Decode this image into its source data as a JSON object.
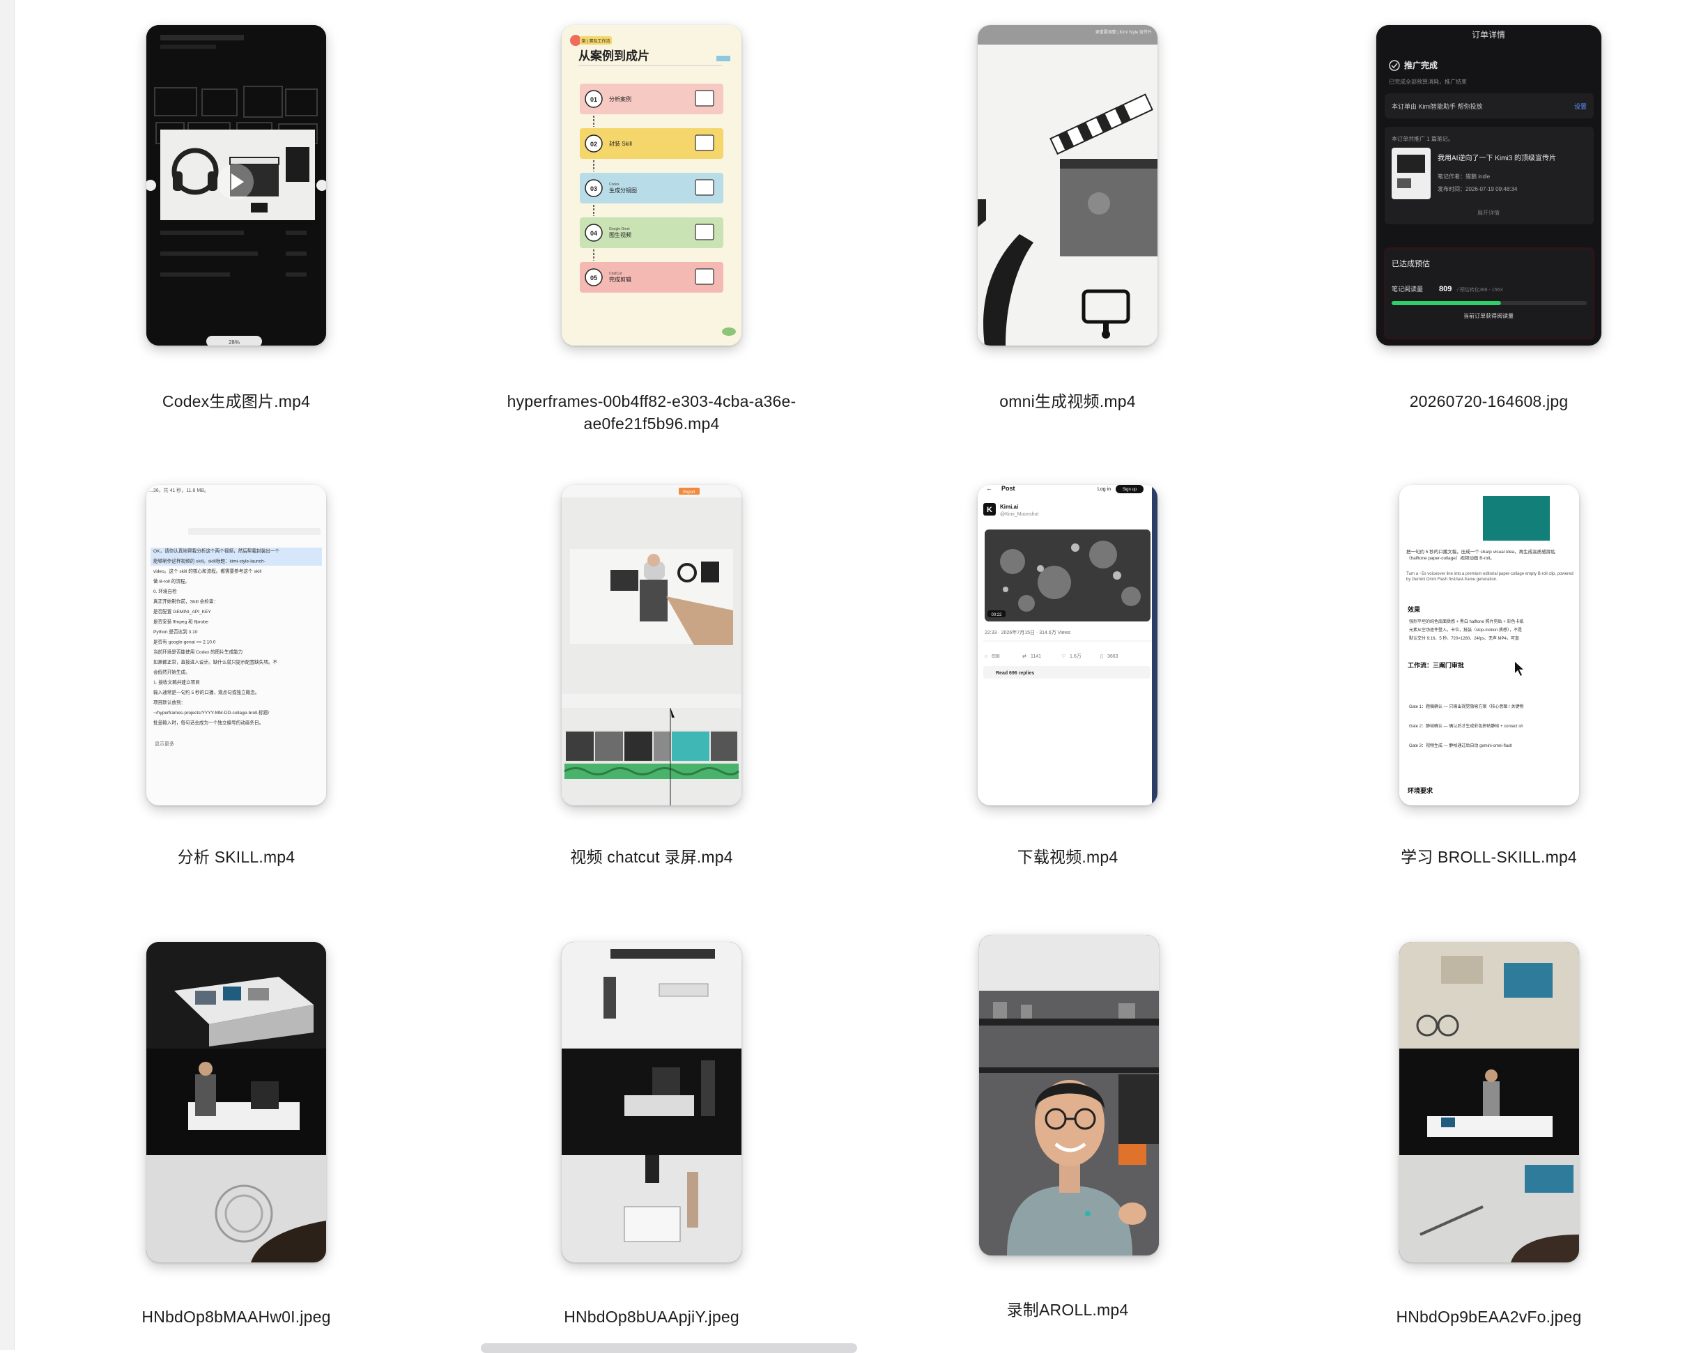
{
  "files": [
    {
      "name": "Codex生成图片.mp4",
      "thumb": {
        "zoom": "28%"
      }
    },
    {
      "name": "hyperframes-00b4ff82-e303-4cba-a36e-ae0fe21f5b96.mp4",
      "thumb": {
        "heading": "从案例到成片",
        "tag": "案 | 實际工作流",
        "steps": [
          {
            "num": "01",
            "sub": "",
            "label": "分析案例",
            "color": "#f7c9c3"
          },
          {
            "num": "02",
            "sub": "",
            "label": "封装 Skill",
            "color": "#f4d66a"
          },
          {
            "num": "03",
            "sub": "Codex",
            "label": "生成分镜图",
            "color": "#b9dde8"
          },
          {
            "num": "04",
            "sub": "Google Omni",
            "label": "图生视频",
            "color": "#c9e3b4"
          },
          {
            "num": "05",
            "sub": "ChatCut",
            "label": "完成剪辑",
            "color": "#f5b9b4"
          }
        ]
      }
    },
    {
      "name": "omni生成视频.mp4",
      "thumb": {
        "topbar": "更重要调整 | Kimi Style 宣传片"
      }
    },
    {
      "name": "20260720-164608.jpg",
      "thumb": {
        "title": "订单详情",
        "done": "推广完成",
        "done_sub": "已完成全部预算消耗，推广结束",
        "agent": "本订单由 Kimi智能助手 帮你投放",
        "agent_link": "设置",
        "count_line": "本订单共推广 1 篇笔记。",
        "note_title": "我用AI逆向了一下 Kimi3 的顶级宣传片",
        "author": "笔记作者：猎鹅 indie",
        "time": "发布时间：2026-07-19 09:48:34",
        "expand": "展开详情",
        "reach": "已达成预估",
        "read_label": "笔记阅读量",
        "read_value": "809",
        "read_range": "/ 预估转化388 - 1563",
        "read_sub": "当前订单获得阅读量",
        "progress": 0.56
      }
    },
    {
      "name": "分析 SKILL.mp4",
      "thumb": {
        "header": "...36，共 41 秒，11.6 MB。",
        "lines": [
          "OK，请你认真地帮我分析这个两个视频，然后帮我封装出一个",
          "能够制作这样视频的 skill。skill标题：kimi-style-launch-",
          "video。这个 skill 的核心和流程。都需要参考这个 skill",
          "做 B-roll 的流程。",
          "0. 环境自检",
          "真正开始制作前，Skill 会检查：",
          "是否配置 GEMINI_API_KEY",
          "是否安装 ffmpeg 和 ffprobe",
          "Python 是否达到 3.10",
          "是否有 google-genai >= 2.10.0",
          "当前环境是否能使用 Codex 的图片生成能力",
          "如果都正常，直接进入设计。缺什么就只提示配置缺失项。不",
          "会假然开始生成。",
          "1. 接收文稿并建立项目",
          "输入通常是一句约 5 秒的口播，观点句或独立概念。",
          "项目默认放到：",
          "~/hyperframes-projects/YYYY-MM-DD-collage-broll-标题/",
          "批量输入时，每句话会成为一个独立编号的动画条目。"
        ],
        "more": "显示更多"
      }
    },
    {
      "name": "视频 chatcut 录屏.mp4",
      "thumb": {
        "export": "Export"
      }
    },
    {
      "name": "下载视频.mp4",
      "thumb": {
        "post": "Post",
        "login": "Log in",
        "signup": "Sign up",
        "account": "Kimi.ai",
        "handle": "@Kimi_Moonshot",
        "duration": "00:22",
        "meta": "22:33 · 2026年7月15日 · 314.6万 Views",
        "stats": [
          "698",
          "1141",
          "1.6万",
          "3663"
        ],
        "replies": "Read 696 replies"
      }
    },
    {
      "name": "学习 BROLL-SKILL.mp4",
      "thumb": {
        "intro": "把一句约 5 秒的口播文稿，压成一个 sharp visual idea，再生成高质感拼贴（halftone paper-collage）视频动画 B-roll。",
        "intro_en": "Turn a ~5s voiceover line into a premium editorial paper-collage empty B-roll clip, powered by Gemini Omni Flash first/last-frame generation.",
        "effect": "效果",
        "bullets": [
          "强烈平坦的纯色底面质感 + 黑白 halftone 照片剪贴 + 彩色卡纸",
          "元素从空场逐件登入，卡位，抵装（stop-motion 质感），不是",
          "默认交付 9:16、5 秒、720×1280、24fps、无声 MP4，可直"
        ],
        "workflow": "工作流：三阐门审批",
        "gates": [
          "Gate 1：题稿确认 — 只输出视觉隐喻方案（核心意图 / 关键物",
          "Gate 2：静帧确认 — 确认后才生成彩色拼贴静帧 + contact sh",
          "Gate 3：视频生成 — 静帧通过后自动 gemini-omni-flash"
        ],
        "env": "环境要求"
      }
    },
    {
      "name": "HNbdOp8bMAAHw0I.jpeg",
      "thumb": {}
    },
    {
      "name": "HNbdOp8bUAApjiY.jpeg",
      "thumb": {}
    },
    {
      "name": "录制AROLL.mp4",
      "thumb": {}
    },
    {
      "name": "HNbdOp9bEAA2vFo.jpeg",
      "thumb": {}
    }
  ]
}
